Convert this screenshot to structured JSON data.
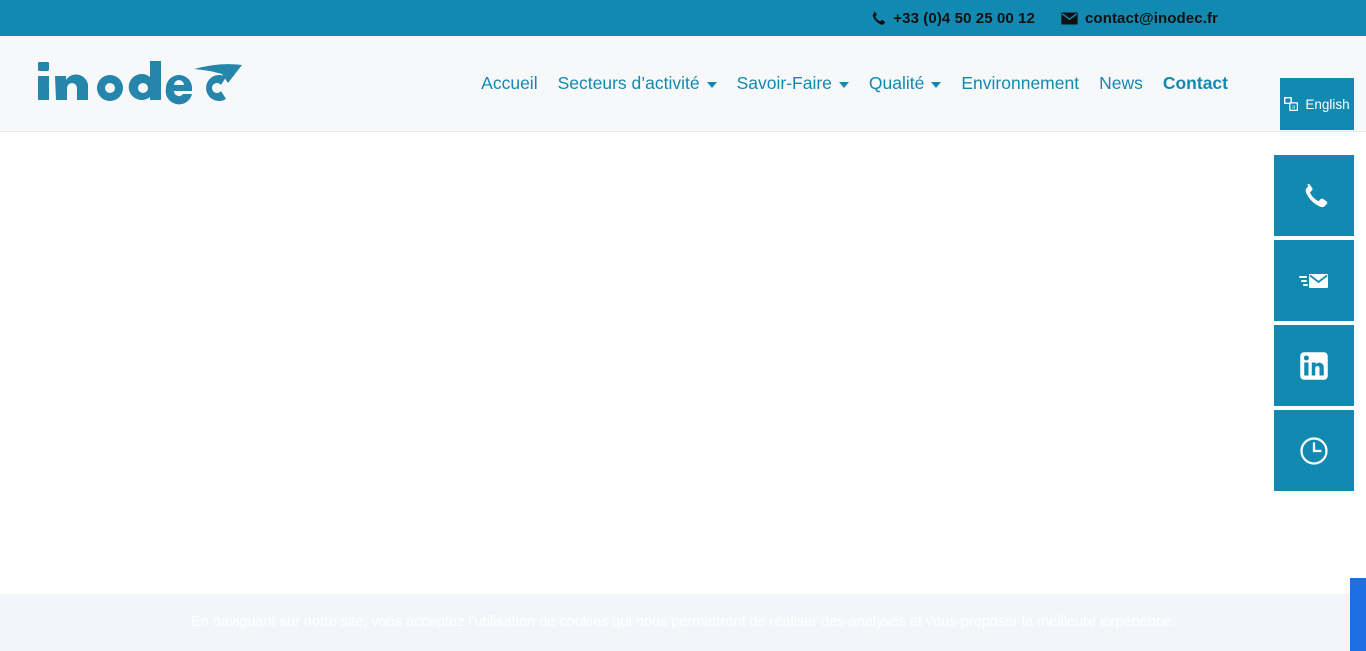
{
  "colors": {
    "brand_teal": "#1289b0",
    "header_bg": "#f7f8f9",
    "topbar_text": "#111111",
    "cookie_bg": "#f2f6fa",
    "corner_tab": "#1b6fe0"
  },
  "topbar": {
    "phone": {
      "label": "+33 (0)4 50 25 00 12",
      "icon": "phone-icon"
    },
    "email": {
      "label": "contact@inodec.fr",
      "icon": "envelope-icon"
    }
  },
  "header": {
    "logo_text": "inodec",
    "nav": [
      {
        "label": "Accueil",
        "has_dropdown": false,
        "active": false
      },
      {
        "label": "Secteurs d’activité",
        "has_dropdown": true,
        "active": false
      },
      {
        "label": "Savoir-Faire",
        "has_dropdown": true,
        "active": false
      },
      {
        "label": "Qualité",
        "has_dropdown": true,
        "active": false
      },
      {
        "label": "Environnement",
        "has_dropdown": false,
        "active": false
      },
      {
        "label": "News",
        "has_dropdown": false,
        "active": false
      },
      {
        "label": "Contact",
        "has_dropdown": false,
        "active": true
      }
    ],
    "language_button": {
      "label": "English",
      "icon": "translate-icon"
    }
  },
  "side_rail": [
    {
      "name": "phone",
      "icon": "phone-icon"
    },
    {
      "name": "email",
      "icon": "send-mail-icon"
    },
    {
      "name": "linkedin",
      "icon": "linkedin-icon"
    },
    {
      "name": "hours",
      "icon": "clock-icon"
    }
  ],
  "cookie_banner": {
    "message": "En naviguant sur notre site, vous acceptez l’utilisation de cookies qui nous permettront de réaliser des analyses et vous proposer la meilleure expérience."
  },
  "main": {
    "content": ""
  }
}
